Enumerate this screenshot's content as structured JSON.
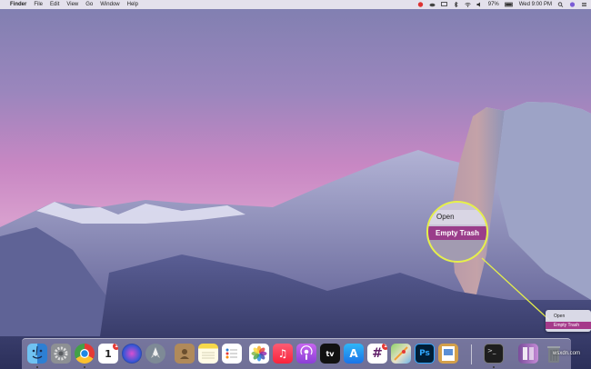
{
  "menubar": {
    "apple_symbol": "",
    "items": [
      "Finder",
      "File",
      "Edit",
      "View",
      "Go",
      "Window",
      "Help"
    ],
    "battery": "97%",
    "clock": "Wed 9:00 PM"
  },
  "context_menu": {
    "items": [
      "Open",
      "Empty Trash"
    ],
    "selected": "Empty Trash"
  },
  "magnifier": {
    "items": [
      "Open",
      "Empty Trash"
    ]
  },
  "dock": {
    "apps": [
      {
        "name": "Finder",
        "icon": "finder-icon"
      },
      {
        "name": "System Preferences",
        "icon": "gear-icon"
      },
      {
        "name": "Chrome",
        "icon": "chrome-icon"
      },
      {
        "name": "Calendar",
        "icon": "calendar-icon",
        "text": "1"
      },
      {
        "name": "Siri",
        "icon": "siri-icon"
      },
      {
        "name": "Launchpad",
        "icon": "rocket-icon"
      },
      {
        "name": "Contacts",
        "icon": "contacts-icon"
      },
      {
        "name": "Notes",
        "icon": "notes-icon"
      },
      {
        "name": "Reminders",
        "icon": "reminders-icon"
      },
      {
        "name": "Photos",
        "icon": "photos-icon"
      },
      {
        "name": "Music",
        "icon": "music-icon",
        "text": "♫"
      },
      {
        "name": "Podcasts",
        "icon": "podcasts-icon"
      },
      {
        "name": "TV",
        "icon": "tv-icon",
        "text": "tv"
      },
      {
        "name": "App Store",
        "icon": "app-store-icon",
        "text": "A"
      },
      {
        "name": "Slack",
        "icon": "slack-icon",
        "text": "#"
      },
      {
        "name": "Maps",
        "icon": "maps-icon"
      },
      {
        "name": "Photoshop",
        "icon": "photoshop-icon",
        "text": "Ps"
      },
      {
        "name": "Preview",
        "icon": "preview-icon"
      },
      {
        "name": "Terminal",
        "icon": "terminal-icon",
        "text": ">_"
      },
      {
        "name": "Downloads",
        "icon": "downloads-icon"
      },
      {
        "name": "Trash",
        "icon": "trash-icon"
      }
    ],
    "calendar_badge": "1",
    "slack_badge": "1"
  },
  "watermark": "wsxdn.com",
  "colors": {
    "highlight": "#a53a8a",
    "magnifier_ring": "#e6f04a"
  }
}
